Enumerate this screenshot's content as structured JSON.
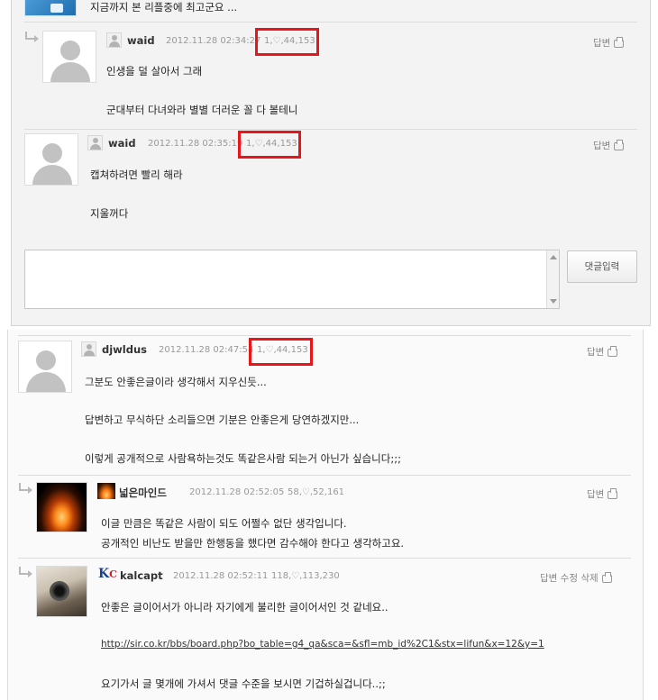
{
  "comments": [
    {
      "author": "",
      "body": [
        "지금까지 본 리플중에 최고군요 ..."
      ]
    },
    {
      "author": "waid",
      "timestamp": "2012.11.28 02:34:27",
      "score": "1,♡,44,153",
      "actions": "답변",
      "body": [
        "인생을 덜 살아서 그래",
        "군대부터 다녀와라 별별 더러운 꼴 다 볼테니"
      ]
    },
    {
      "author": "waid",
      "timestamp": "2012.11.28 02:35:19",
      "score": "1,♡,44,153",
      "actions": "답변",
      "body": [
        "캡쳐하려면 빨리 해라",
        "지울꺼다"
      ]
    },
    {
      "author": "djwldus",
      "timestamp": "2012.11.28 02:47:54",
      "score": "1,♡,44,153",
      "actions": "답변",
      "body": [
        "그분도 안좋은글이라 생각해서 지우신듯...",
        "답변하고 무식하단 소리들으면 기분은 안좋은게 당연하겠지만...",
        "이렇게 공개적으로 사람욕하는것도 똑같은사람 되는거 아닌가 싶습니다;;;"
      ]
    },
    {
      "author": "넓은마인드",
      "timestamp": "2012.11.28 02:52:05",
      "score": "58,♡,52,161",
      "actions": "답변",
      "body": [
        "이글 만큼은 똑같은 사람이 되도 어쩔수 없단 생각입니다.",
        "공개적인 비난도 받을만 한행동을 했다면 감수해야 한다고 생각하고요."
      ]
    },
    {
      "author": "kalcapt",
      "timestamp": "2012.11.28 02:52:11",
      "score": "118,♡,113,230",
      "actions": "답변 수정 삭제",
      "body": [
        "안좋은 글이어서가 아니라 자기에게 불리한 글이어서인 것 같네요..",
        "http://sir.co.kr/bbs/board.php?bo_table=g4_qa&sca=&sfl=mb_id%2C1&stx=lifun&x=12&y=1",
        "요기가서 글 몇개에 가셔서 댓글 수준을 보시면 기겁하실겁니다..;;"
      ]
    }
  ],
  "comment_form": {
    "textarea_value": "",
    "submit_label": "댓글입력"
  },
  "icons": {
    "print": "printer-icon",
    "reply": "reply-arrow-icon",
    "default_avatar": "user-silhouette-icon"
  },
  "colors": {
    "highlight_box": "#e8151b",
    "panel_bg": "#f3f3f3"
  }
}
